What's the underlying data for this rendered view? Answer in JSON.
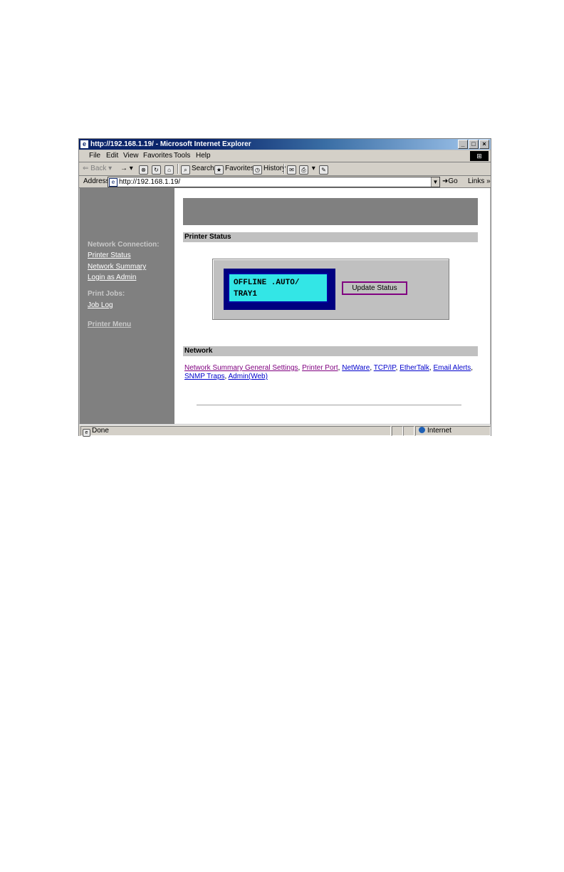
{
  "window": {
    "title": "http://192.168.1.19/ - Microsoft Internet Explorer",
    "buttons": [
      "_",
      "□",
      "×"
    ]
  },
  "menubar": {
    "items": [
      "File",
      "Edit",
      "View",
      "Favorites",
      "Tools",
      "Help"
    ]
  },
  "toolbar": {
    "back": "Back",
    "forward": "→",
    "search": "Search",
    "favorites": "Favorites",
    "history": "History"
  },
  "address": {
    "label": "Address",
    "url": "http://192.168.1.19/",
    "go": "Go",
    "links": "Links"
  },
  "sidebar": {
    "network_heading": "Network Connection:",
    "network_links": [
      "Printer Status",
      "Network Summary",
      "Login as Admin"
    ],
    "jobs_heading": "Print Jobs:",
    "jobs_links": [
      "Job Log"
    ],
    "menu_link": "Printer Menu"
  },
  "main": {
    "printer_status_heading": "Printer Status",
    "lcd_line1": "OFFLINE .AUTO/",
    "lcd_line2": "TRAY1",
    "update_button": "Update Status",
    "network_heading": "Network",
    "network_links": [
      "Network Summary General Settings",
      "Printer Port",
      "NetWare",
      "TCP/IP",
      "EtherTalk",
      "Email Alerts",
      "SNMP Traps",
      "Admin(Web)"
    ]
  },
  "statusbar": {
    "status": "Done",
    "zone": "Internet"
  },
  "colors": {
    "titlebar": "#0a246a",
    "sidebar": "#808080",
    "lcd": "#33e6e6",
    "lcd_frame": "#000080",
    "visited_link": "#800080",
    "link": "#0000cc"
  }
}
